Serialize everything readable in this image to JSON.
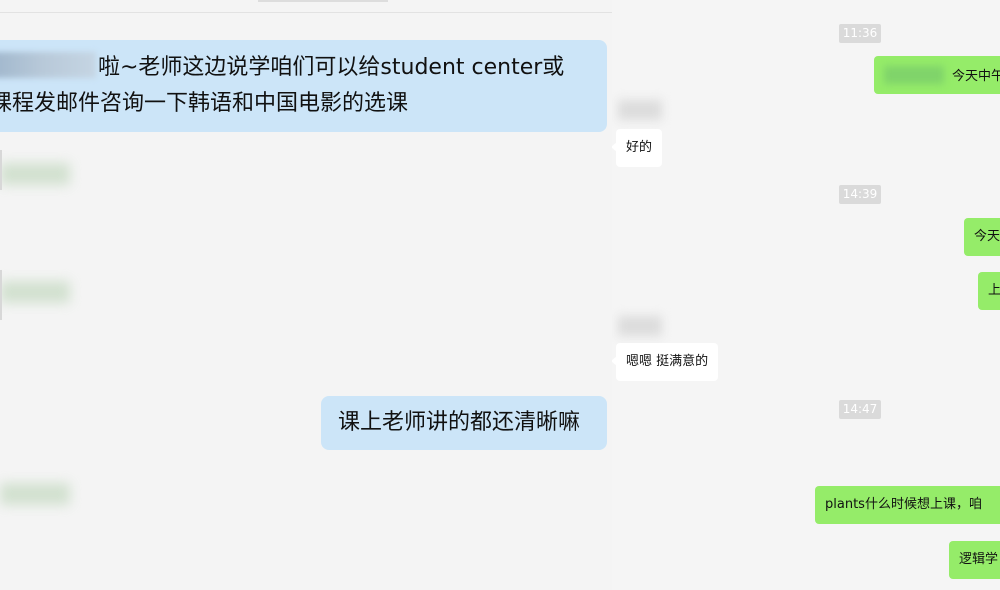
{
  "left": {
    "bubble1": {
      "line1": "啦~老师这边说学咱们可以给student center或",
      "line2": "课程发邮件咨询一下韩语和中国电影的选课"
    },
    "bubble2": "课上老师讲的都还清晰嘛"
  },
  "right": {
    "times": [
      "11:36",
      "14:39",
      "14:47"
    ],
    "messages": {
      "green1": "今天中午",
      "white1": "好的",
      "green2": "今天",
      "green3": "上",
      "white2": "嗯嗯 挺满意的",
      "green4": "plants什么时候想上课，咱",
      "green5": "逻辑学"
    }
  }
}
